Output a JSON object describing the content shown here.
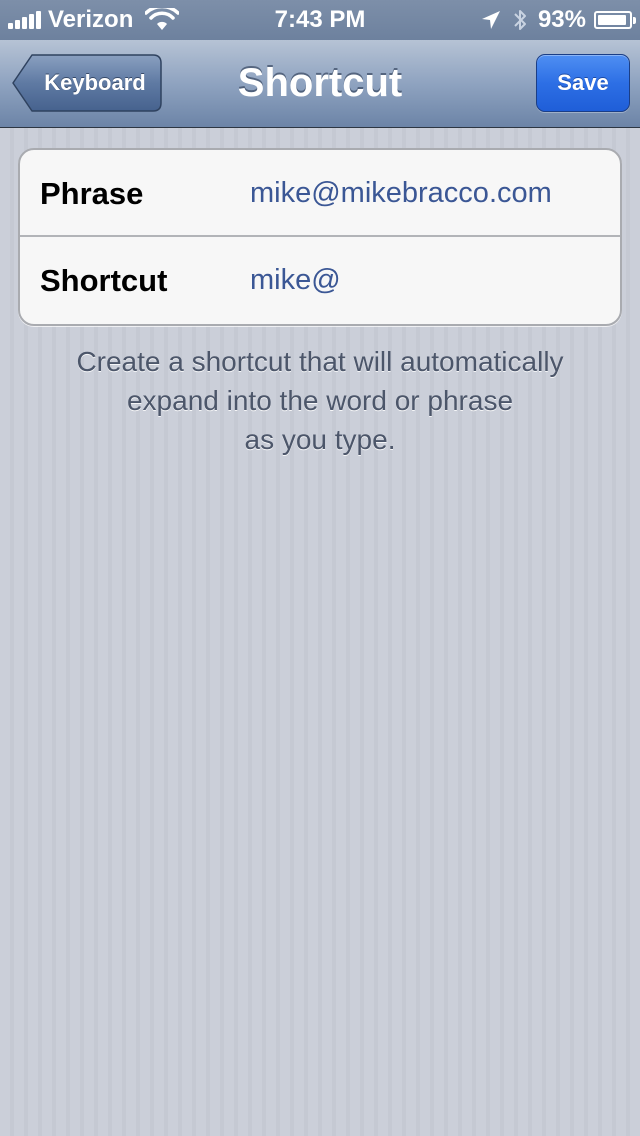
{
  "status_bar": {
    "carrier": "Verizon",
    "time": "7:43 PM",
    "battery_percent": "93%",
    "battery_level": 0.93,
    "icons": [
      "signal-bars-icon",
      "wifi-icon",
      "location-arrow-icon",
      "bluetooth-icon",
      "battery-icon"
    ]
  },
  "nav": {
    "back_label": "Keyboard",
    "title": "Shortcut",
    "save_label": "Save"
  },
  "form": {
    "rows": [
      {
        "label": "Phrase",
        "value": "mike@mikebracco.com"
      },
      {
        "label": "Shortcut",
        "value": "mike@"
      }
    ]
  },
  "footer": {
    "lines": [
      "Create a shortcut that will automatically",
      "expand into the word or phrase",
      "as you type."
    ]
  },
  "colors": {
    "accent_blue": "#2d6fe5",
    "value_text": "#3b5795",
    "background": "#c8ccd6"
  }
}
